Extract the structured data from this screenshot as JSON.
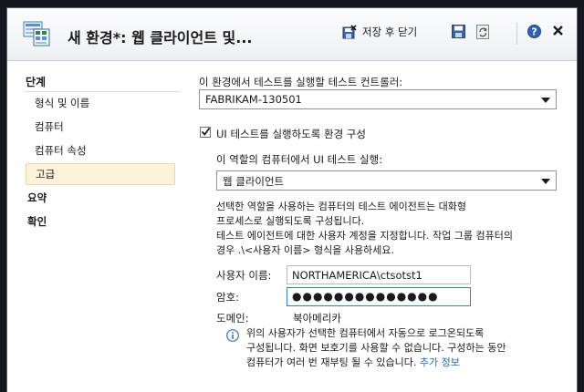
{
  "window": {
    "title": "새 환경*: 웹 클라이언트 및...",
    "save_close_label": "저장 후 닫기",
    "save_icon": "save-icon",
    "refresh_icon": "refresh-icon",
    "help_icon": "help-icon",
    "close_icon": "close-icon"
  },
  "sidebar": {
    "header": "단계",
    "items": [
      {
        "label": "형식 및 이름"
      },
      {
        "label": "컴퓨터"
      },
      {
        "label": "컴퓨터 속성"
      },
      {
        "label": "고급"
      },
      {
        "label": "요약"
      },
      {
        "label": "확인"
      }
    ]
  },
  "main": {
    "controller_label": "이 환경에서 테스트를 실행할 테스트 컨트롤러:",
    "controller_value": "FABRIKAM-130501",
    "ui_test_checkbox_label": "UI 테스트를 실행하도록 환경 구성",
    "ui_test_checked": true,
    "role_label": "이 역할의 컴퓨터에서 UI 테스트 실행:",
    "role_value": "웹 클라이언트",
    "desc1_line1": "선택한 역할을 사용하는 컴퓨터의 테스트 에이전트는 대화형",
    "desc1_line2": "프로세스로 실행되도록 구성됩니다.",
    "desc2_line1": "테스트 에이전트에 대한 사용자 계정을 지정합니다. 작업 그룹 컴퓨터의",
    "desc2_line2": "경우 .\\<사용자 이름> 형식을 사용하세요.",
    "username_label": "사용자 이름:",
    "username_value": "NORTHAMERICA\\ctsotst1",
    "password_label": "암호:",
    "password_value": "●●●●●●●●●●●●●●",
    "domain_label": "도메인:",
    "domain_value": "북아메리카",
    "info_line1": "위의 사용자가 선택한 컴퓨터에서 자동으로 로그온되도록",
    "info_line2": "구성됩니다. 화면 보호기를 사용할 수 없습니다. 구성하는 동안",
    "info_line3": "컴퓨터가 여러 번 재부팅 될 수 있습니다.",
    "more_info_link": "추가 정보"
  }
}
